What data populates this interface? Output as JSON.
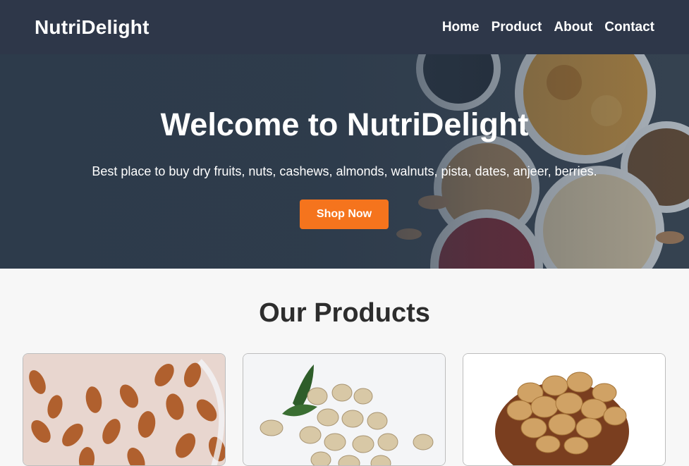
{
  "navbar": {
    "brand": "NutriDelight",
    "links": [
      {
        "label": "Home"
      },
      {
        "label": "Product"
      },
      {
        "label": "About"
      },
      {
        "label": "Contact"
      }
    ]
  },
  "hero": {
    "title": "Welcome to NutriDelight",
    "subtitle": "Best place to buy dry fruits, nuts, cashews, almonds, walnuts, pista, dates, anjeer, berries.",
    "cta_label": "Shop Now",
    "background_image": "dry-fruits-bowls-image"
  },
  "products": {
    "title": "Our Products",
    "cards": [
      {
        "image": "almonds-image"
      },
      {
        "image": "pistachios-image"
      },
      {
        "image": "walnuts-image"
      }
    ]
  },
  "colors": {
    "navbar_bg": "#2e3749",
    "hero_overlay": "#2c3a4a",
    "accent": "#f5741d",
    "page_bg": "#f7f7f7",
    "heading_text": "#2d2d2d"
  }
}
